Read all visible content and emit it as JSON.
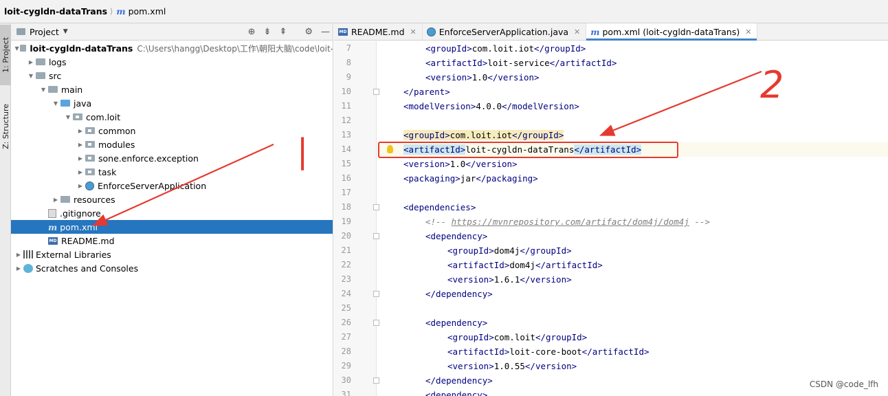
{
  "breadcrumb": {
    "project": "loit-cygldn-dataTrans",
    "file": "pom.xml",
    "file_icon": "m"
  },
  "tool_strip": {
    "project_tab": "1: Project",
    "structure_tab": "Z: Structure"
  },
  "panel": {
    "title": "Project"
  },
  "tree": [
    {
      "depth": 0,
      "arrow": "open",
      "icon": "module",
      "label": "loit-cygldn-dataTrans",
      "bold": true,
      "path": "C:\\Users\\hangg\\Desktop\\工作\\朝阳大脑\\code\\loit-"
    },
    {
      "depth": 1,
      "arrow": "closed",
      "icon": "folder",
      "label": "logs"
    },
    {
      "depth": 1,
      "arrow": "open",
      "icon": "folder",
      "label": "src"
    },
    {
      "depth": 2,
      "arrow": "open",
      "icon": "folder",
      "label": "main"
    },
    {
      "depth": 3,
      "arrow": "open",
      "icon": "folder-blue",
      "label": "java"
    },
    {
      "depth": 4,
      "arrow": "open",
      "icon": "package",
      "label": "com.loit"
    },
    {
      "depth": 5,
      "arrow": "closed",
      "icon": "package",
      "label": "common"
    },
    {
      "depth": 5,
      "arrow": "closed",
      "icon": "package",
      "label": "modules"
    },
    {
      "depth": 5,
      "arrow": "closed",
      "icon": "package",
      "label": "sone.enforce.exception"
    },
    {
      "depth": 5,
      "arrow": "closed",
      "icon": "package",
      "label": "task"
    },
    {
      "depth": 5,
      "arrow": "closed",
      "icon": "class",
      "label": "EnforceServerApplication"
    },
    {
      "depth": 3,
      "arrow": "closed",
      "icon": "folder",
      "label": "resources"
    },
    {
      "depth": 2,
      "arrow": "none",
      "icon": "git",
      "label": ".gitignore"
    },
    {
      "depth": 2,
      "arrow": "none",
      "icon": "maven",
      "label": "pom.xml",
      "selected": true
    },
    {
      "depth": 2,
      "arrow": "none",
      "icon": "md",
      "label": "README.md"
    },
    {
      "depth": 0,
      "arrow": "closed",
      "icon": "library",
      "label": "External Libraries"
    },
    {
      "depth": 0,
      "arrow": "closed",
      "icon": "scratches",
      "label": "Scratches and Consoles"
    }
  ],
  "tabs": [
    {
      "icon": "md",
      "label": "README.md",
      "active": false
    },
    {
      "icon": "class",
      "label": "EnforceServerApplication.java",
      "active": false
    },
    {
      "icon": "maven",
      "label": "pom.xml (loit-cygldn-dataTrans)",
      "active": true
    }
  ],
  "code_lines": [
    {
      "n": "7",
      "indent": 2,
      "parts": [
        [
          "tag",
          "<groupId>"
        ],
        [
          "text",
          "com.loit.iot"
        ],
        [
          "tag",
          "</groupId>"
        ]
      ]
    },
    {
      "n": "8",
      "indent": 2,
      "parts": [
        [
          "tag",
          "<artifactId>"
        ],
        [
          "text",
          "loit-service"
        ],
        [
          "tag",
          "</artifactId>"
        ]
      ]
    },
    {
      "n": "9",
      "indent": 2,
      "parts": [
        [
          "tag",
          "<version>"
        ],
        [
          "text",
          "1.0"
        ],
        [
          "tag",
          "</version>"
        ]
      ]
    },
    {
      "n": "10",
      "indent": 1,
      "parts": [
        [
          "tag",
          "</parent>"
        ]
      ]
    },
    {
      "n": "11",
      "indent": 1,
      "parts": [
        [
          "tag",
          "<modelVersion>"
        ],
        [
          "text",
          "4.0.0"
        ],
        [
          "tag",
          "</modelVersion>"
        ]
      ]
    },
    {
      "n": "12",
      "indent": 0,
      "parts": []
    },
    {
      "n": "13",
      "indent": 1,
      "parts": [
        [
          "tag",
          "<groupId>"
        ],
        [
          "text",
          "com.loit.iot"
        ],
        [
          "tag",
          "</groupId>"
        ]
      ],
      "hl": true
    },
    {
      "n": "14",
      "indent": 1,
      "parts": [
        [
          "match",
          "<artifactId>"
        ],
        [
          "text",
          "loit-cygldn-dataTrans"
        ],
        [
          "match",
          "</artifactId>"
        ]
      ],
      "caret": true
    },
    {
      "n": "15",
      "indent": 1,
      "parts": [
        [
          "tag",
          "<version>"
        ],
        [
          "text",
          "1.0"
        ],
        [
          "tag",
          "</version>"
        ]
      ]
    },
    {
      "n": "16",
      "indent": 1,
      "parts": [
        [
          "tag",
          "<packaging>"
        ],
        [
          "text",
          "jar"
        ],
        [
          "tag",
          "</packaging>"
        ]
      ]
    },
    {
      "n": "17",
      "indent": 0,
      "parts": []
    },
    {
      "n": "18",
      "indent": 1,
      "parts": [
        [
          "tag",
          "<dependencies>"
        ]
      ]
    },
    {
      "n": "19",
      "indent": 2,
      "parts": [
        [
          "comment",
          "<!-- "
        ],
        [
          "link",
          "https://mvnrepository.com/artifact/dom4j/dom4j"
        ],
        [
          "comment",
          " -->"
        ]
      ]
    },
    {
      "n": "20",
      "indent": 2,
      "parts": [
        [
          "tag",
          "<dependency>"
        ]
      ]
    },
    {
      "n": "21",
      "indent": 3,
      "parts": [
        [
          "tag",
          "<groupId>"
        ],
        [
          "text",
          "dom4j"
        ],
        [
          "tag",
          "</groupId>"
        ]
      ]
    },
    {
      "n": "22",
      "indent": 3,
      "parts": [
        [
          "tag",
          "<artifactId>"
        ],
        [
          "text",
          "dom4j"
        ],
        [
          "tag",
          "</artifactId>"
        ]
      ]
    },
    {
      "n": "23",
      "indent": 3,
      "parts": [
        [
          "tag",
          "<version>"
        ],
        [
          "text",
          "1.6.1"
        ],
        [
          "tag",
          "</version>"
        ]
      ]
    },
    {
      "n": "24",
      "indent": 2,
      "parts": [
        [
          "tag",
          "</dependency>"
        ]
      ]
    },
    {
      "n": "25",
      "indent": 0,
      "parts": []
    },
    {
      "n": "26",
      "indent": 2,
      "parts": [
        [
          "tag",
          "<dependency>"
        ]
      ]
    },
    {
      "n": "27",
      "indent": 3,
      "parts": [
        [
          "tag",
          "<groupId>"
        ],
        [
          "text",
          "com.loit"
        ],
        [
          "tag",
          "</groupId>"
        ]
      ]
    },
    {
      "n": "28",
      "indent": 3,
      "parts": [
        [
          "tag",
          "<artifactId>"
        ],
        [
          "text",
          "loit-core-boot"
        ],
        [
          "tag",
          "</artifactId>"
        ]
      ]
    },
    {
      "n": "29",
      "indent": 3,
      "parts": [
        [
          "tag",
          "<version>"
        ],
        [
          "text",
          "1.0.55"
        ],
        [
          "tag",
          "</version>"
        ]
      ]
    },
    {
      "n": "30",
      "indent": 2,
      "parts": [
        [
          "tag",
          "</dependency>"
        ]
      ]
    },
    {
      "n": "31",
      "indent": 2,
      "parts": [
        [
          "tag",
          "<dependency>"
        ]
      ]
    }
  ],
  "annotations": {
    "label_1": "|",
    "label_2": "2"
  },
  "watermark": "CSDN @code_lfh",
  "colors": {
    "selection": "#2675bf",
    "annotation": "#e53a2f",
    "tag": "#000080",
    "comment": "#808080"
  }
}
